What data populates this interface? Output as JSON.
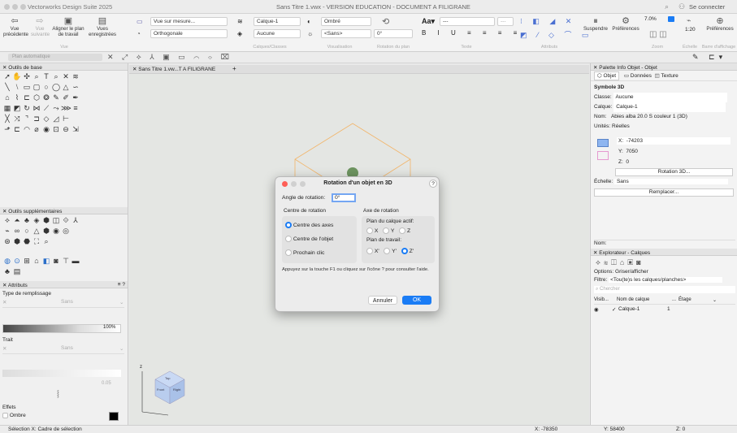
{
  "window": {
    "app_title": "Vectorworks Design Suite 2025",
    "doc_title": "Sans Titre 1.vwx - VERSION EDUCATION - DOCUMENT A FILIGRANE",
    "connect": "Se connecter"
  },
  "ribbon": {
    "vue_precedente": "Vue précédente",
    "vue_suivante": "Vue suivante",
    "aligner_plan": "Aligner le plan de travail",
    "vues_enregistrees": "Vues enregistrées",
    "vue_group": "Vue",
    "vue_sur_mesure": "Vue sur mesure...",
    "orthogonale": "Orthogonale",
    "calque": "Calque-1",
    "aucune": "Aucune",
    "calques_classes": "Calques/Classes",
    "ombre": "Ombré",
    "sans": "<Sans>",
    "visualisation": "Visualisation",
    "rotation_plan": "Rotation du plan",
    "angle": "0°",
    "texte": "Texte",
    "font_size": "---",
    "attributs": "Attributs",
    "suspendre": "Suspendre",
    "preferences": "Préférences",
    "zoom_pct": "7.0%",
    "zoom": "Zoom",
    "echelle_val": "1:20",
    "echelle": "Échelle",
    "barre": "Barre d'affichage",
    "preferences2": "Préférences",
    "plan_auto": "Plan automatique"
  },
  "left": {
    "outils_de_base": "Outils de base",
    "outils_supp": "Outils supplémentaires",
    "attributs": "Attributs",
    "type_remplissage": "Type de remplissage",
    "remplissage_val": "Sans",
    "opacity": "100%",
    "trait": "Trait",
    "trait_val": "Sans",
    "trait_width": "0.05",
    "effets": "Effets",
    "ombre": "Ombre"
  },
  "canvas": {
    "tab": "Sans Titre 1.vw...T A FILIGRANE",
    "cube_labels": [
      "Top",
      "Front",
      "Right"
    ]
  },
  "dialog": {
    "title": "Rotation d'un objet en 3D",
    "angle_label": "Angle de rotation:",
    "angle_value": "0°",
    "centre_title": "Centre de rotation",
    "centre_opts": [
      "Centre des axes",
      "Centre de l'objet",
      "Prochain clic"
    ],
    "axe_title": "Axe de rotation",
    "plan_calque": "Plan du calque actif:",
    "plan_calque_opts": [
      "X",
      "Y",
      "Z"
    ],
    "plan_travail": "Plan de travail:",
    "plan_travail_opts": [
      "X'",
      "Y'",
      "Z'"
    ],
    "help": "Appuyez sur la touche F1 ou cliquez sur l'icône ? pour consulter l'aide.",
    "cancel": "Annuler",
    "ok": "OK"
  },
  "right": {
    "palette_title": "Palette Info Objet - Objet",
    "tab_objet": "Objet",
    "tab_donnees": "Données",
    "tab_texture": "Texture",
    "symbole": "Symbole 3D",
    "classe_label": "Classe:",
    "classe_val": "Aucune",
    "calque_label": "Calque:",
    "calque_val": "Calque-1",
    "nom_label": "Nom:",
    "nom_val": "Abies alba 20.0 S couleur 1 (3D)",
    "unites_label": "Unités:",
    "unites_val": "Réelles",
    "x_label": "X:",
    "x_val": "-74203",
    "y_label": "Y:",
    "y_val": "7050",
    "z_label": "Z:",
    "z_val": "0",
    "rotation_btn": "Rotation 3D...",
    "echelle_label": "Échelle:",
    "echelle_val": "Sans",
    "remplacer_btn": "Remplacer...",
    "nom_bottom": "Nom:",
    "explorer_title": "Explorateur - Calques",
    "options_label": "Options:",
    "options_val": "Griser/afficher",
    "filtre_label": "Filtre:",
    "filtre_val": "<Tou(te)s les calques/planches>",
    "search_placeholder": "Chercher",
    "col_visib": "Visib...",
    "col_nom": "Nom de calque",
    "col_dots": "...",
    "col_etage": "Étage",
    "row_name": "Calque-1",
    "row_num": "1"
  },
  "status": {
    "selection": "Sélection  X: Cadre de sélection",
    "x": "X: -78350",
    "y": "Y: 58400",
    "z": "Z: 0"
  }
}
